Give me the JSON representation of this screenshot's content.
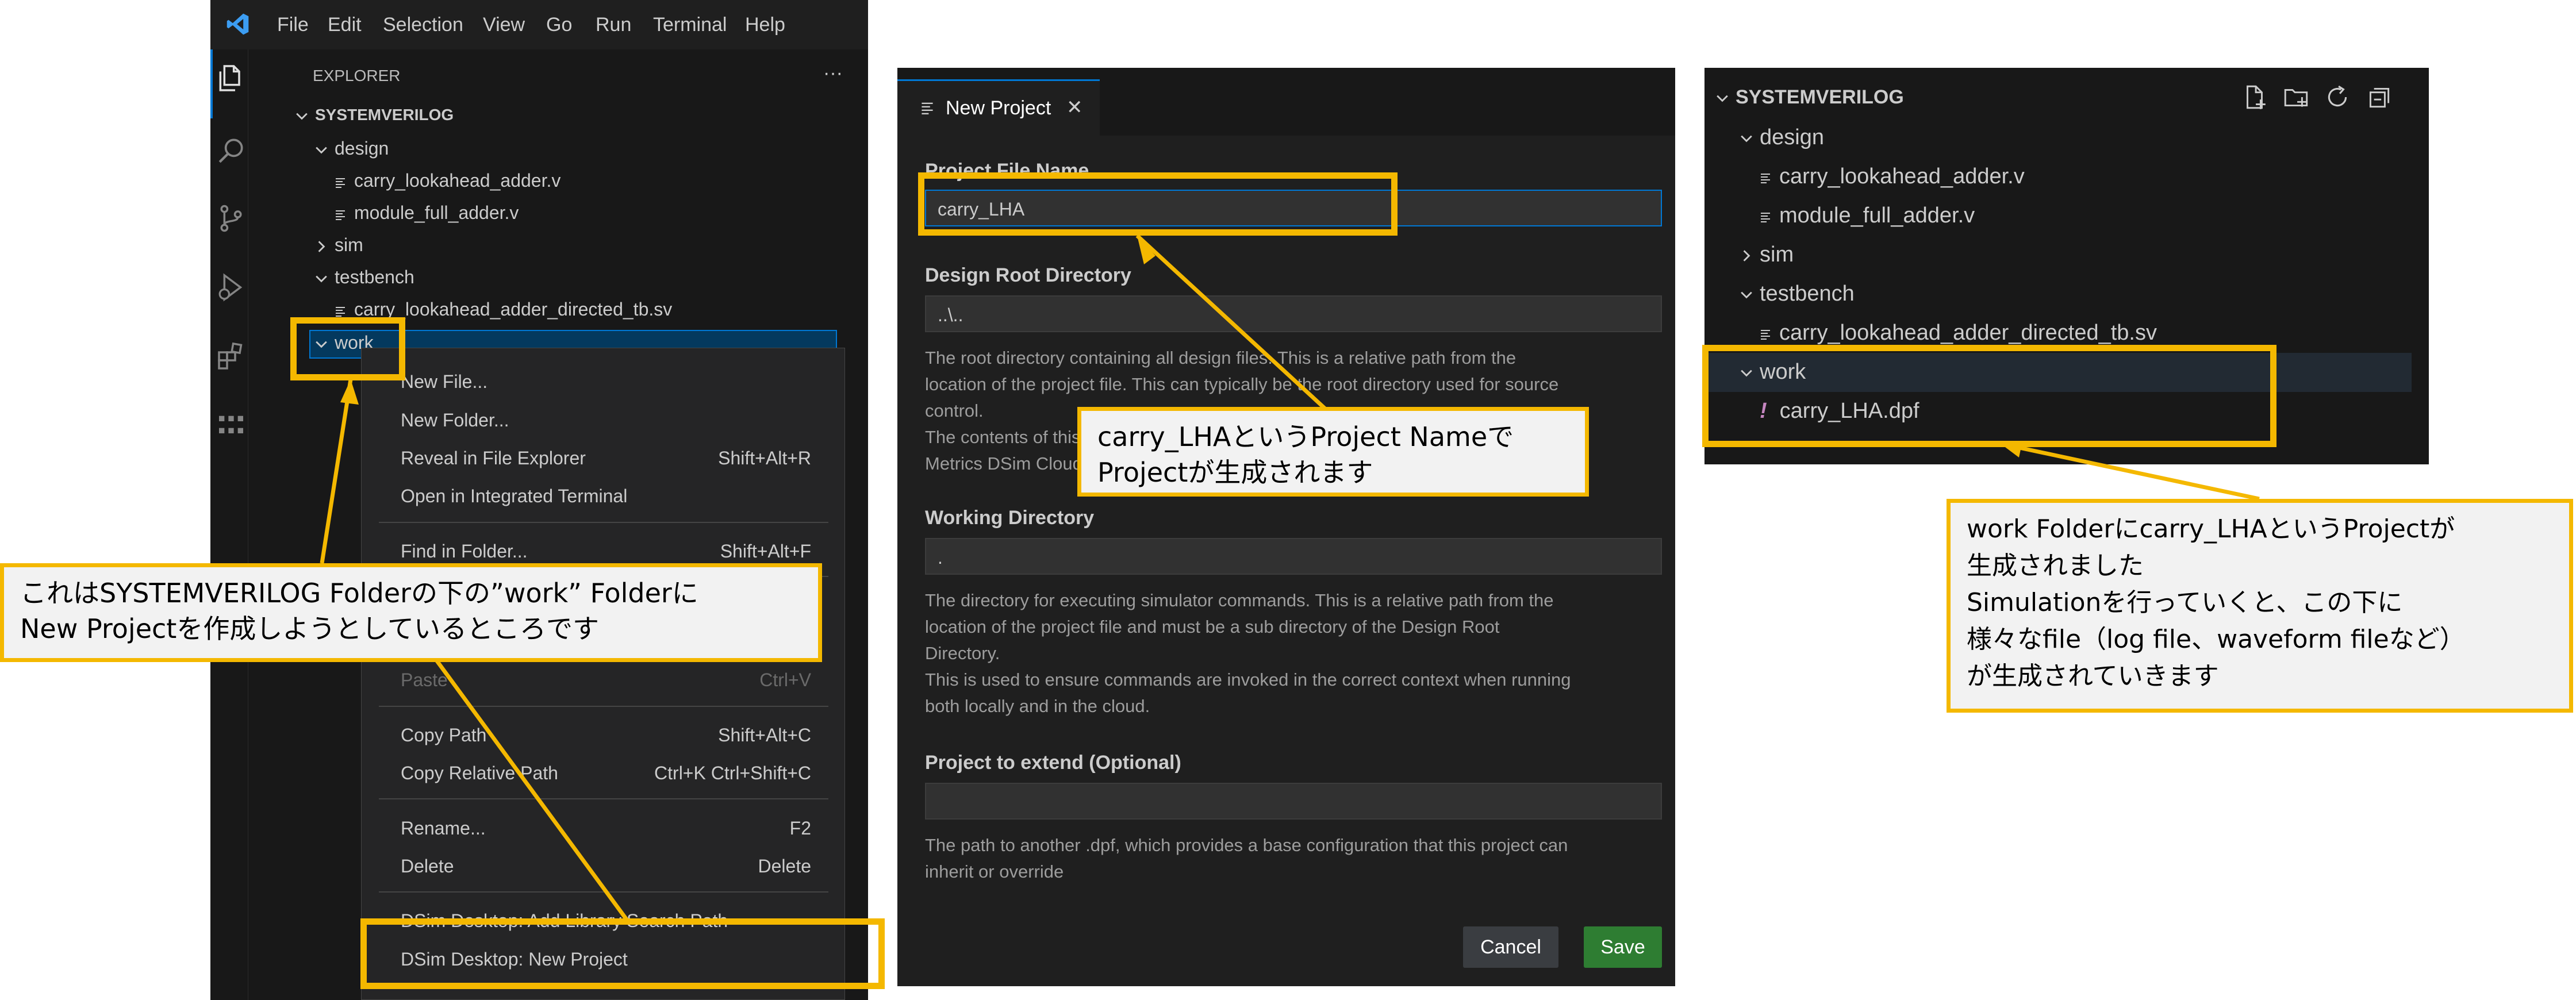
{
  "vscode": {
    "menu": [
      "File",
      "Edit",
      "Selection",
      "View",
      "Go",
      "Run",
      "Terminal",
      "Help"
    ],
    "explorer_title": "EXPLORER",
    "more": "···",
    "root": "SYSTEMVERILOG",
    "tree": [
      "design",
      "carry_lookahead_adder.v",
      "module_full_adder.v",
      "sim",
      "testbench",
      "carry_lookahead_adder_directed_tb.sv",
      "work"
    ]
  },
  "context_menu": {
    "items": [
      {
        "label": "New File...",
        "key": ""
      },
      {
        "label": "New Folder...",
        "key": ""
      },
      {
        "label": "Reveal in File Explorer",
        "key": "Shift+Alt+R"
      },
      {
        "label": "Open in Integrated Terminal",
        "key": ""
      },
      {
        "label": "Find in Folder...",
        "key": "Shift+Alt+F"
      },
      {
        "label": "Paste",
        "key": "Ctrl+V"
      },
      {
        "label": "Copy Path",
        "key": "Shift+Alt+C"
      },
      {
        "label": "Copy Relative Path",
        "key": "Ctrl+K Ctrl+Shift+C"
      },
      {
        "label": "Rename...",
        "key": "F2"
      },
      {
        "label": "Delete",
        "key": "Delete"
      },
      {
        "label": "DSim Desktop: Add Library Search Path",
        "key": ""
      },
      {
        "label": "DSim Desktop: New Project",
        "key": ""
      }
    ]
  },
  "new_project": {
    "tab_title": "New Project",
    "close": "✕",
    "project_file_label": "Project File Name",
    "project_file_value": "carry_LHA",
    "design_root_label": "Design Root Directory",
    "design_root_value": "..\\..",
    "design_root_desc": [
      "The root directory containing all design files. This is a relative path from the",
      "location of the project file. This can typically be the root directory used for source",
      "control.",
      "The contents of this directory will be uploaded when a job is submitted to",
      "Metrics DSim Cloud."
    ],
    "working_dir_label": "Working Directory",
    "working_dir_value": ".",
    "working_dir_desc": [
      "The directory for executing simulator commands. This is a relative path from the",
      "location of the project file and must be a sub directory of the Design Root",
      "Directory.",
      "This is used to ensure commands are invoked in the correct context when running",
      "both locally and in the cloud."
    ],
    "extend_label": "Project to extend (Optional)",
    "extend_value": "",
    "extend_desc": [
      "The path to another .dpf, which provides a base configuration that this project can",
      "inherit or override"
    ],
    "cancel": "Cancel",
    "save": "Save"
  },
  "result_tree": {
    "root": "SYSTEMVERILOG",
    "items": [
      "design",
      "carry_lookahead_adder.v",
      "module_full_adder.v",
      "sim",
      "testbench",
      "carry_lookahead_adder_directed_tb.sv",
      "work",
      "carry_LHA.dpf"
    ],
    "exclaim": "!"
  },
  "callouts": {
    "left": [
      "これはSYSTEMVERILOG Folderの下の”work” Folderに",
      "New Projectを作成しようとしているところです"
    ],
    "middle": [
      "carry_LHAというProject Nameで",
      "Projectが生成されます"
    ],
    "right": [
      "work Folderにcarry_LHAというProjectが",
      "生成されました",
      "Simulationを行っていくと、この下に",
      "様々なfile（log file、waveform fileなど）",
      "が生成されていきます"
    ]
  },
  "colors": {
    "accent": "#f4b800",
    "save": "#2e7d32",
    "vscode_blue": "#0078d4"
  }
}
